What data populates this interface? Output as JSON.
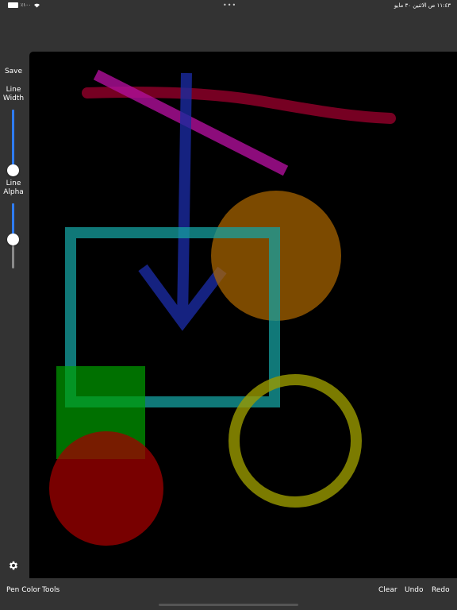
{
  "status_bar": {
    "battery_percent": "٪١٠٠",
    "battery_level": 1.0,
    "multitask_dots": "•••",
    "time_date": "١١:٤٣ ص   الاثنين ٣٠ مايو"
  },
  "sidebar": {
    "save_label": "Save",
    "line_width_label": "Line\nWidth",
    "line_alpha_label": "Line\nAlpha",
    "line_width_value": 0.0,
    "line_alpha_value": 0.55,
    "accent_color": "#2e7cf6",
    "settings_icon": "gear-icon"
  },
  "toolbar": {
    "pen_color_label": "Pen Color",
    "tools_label": "Tools",
    "clear_label": "Clear",
    "undo_label": "Undo",
    "redo_label": "Redo"
  },
  "canvas": {
    "background": "#000000",
    "drawings": [
      {
        "shape": "freehand-stroke",
        "color": "#8b0028"
      },
      {
        "shape": "line",
        "color": "#b0109a"
      },
      {
        "shape": "arrow",
        "color": "#1a2aa0"
      },
      {
        "shape": "filled-circle",
        "color": "#b06a00"
      },
      {
        "shape": "rectangle-outline",
        "color": "#16a0a0"
      },
      {
        "shape": "filled-rectangle",
        "color": "#00a000"
      },
      {
        "shape": "circle-outline",
        "color": "#9a9a00"
      },
      {
        "shape": "filled-circle",
        "color": "#a00000"
      }
    ]
  }
}
